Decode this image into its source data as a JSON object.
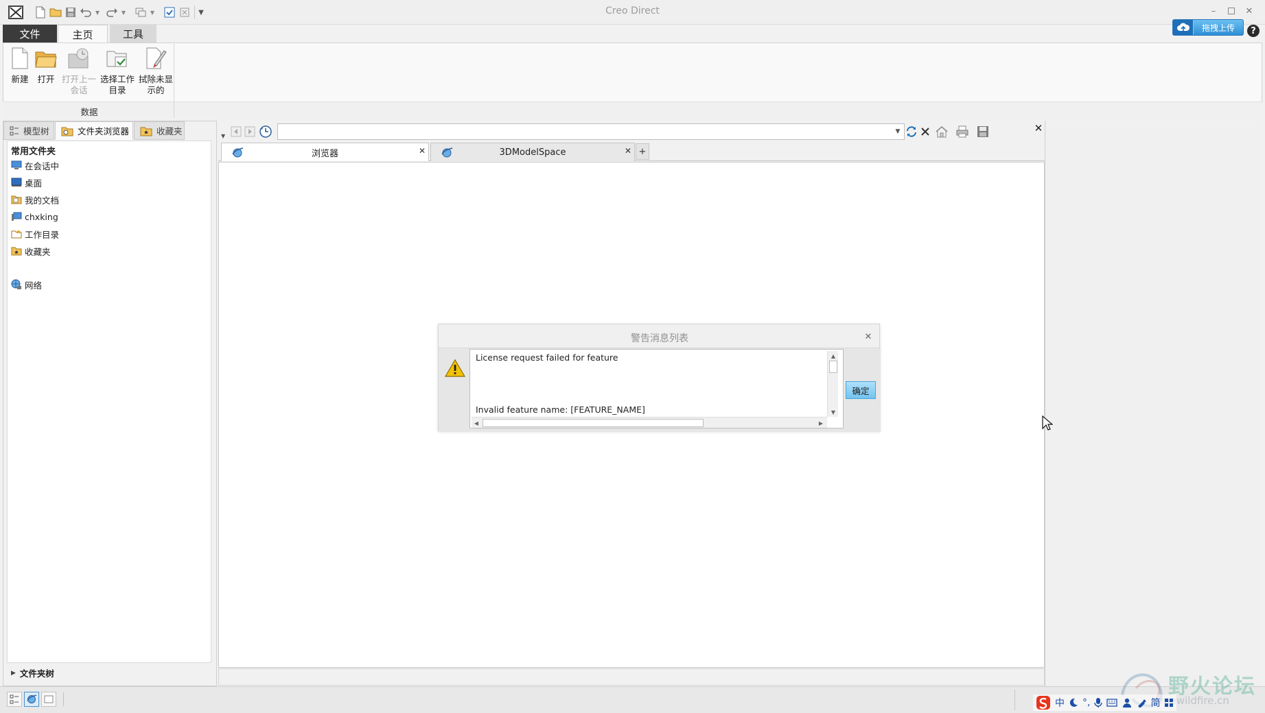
{
  "window": {
    "title": "Creo Direct"
  },
  "menu_tabs": [
    {
      "label": "文件"
    },
    {
      "label": "主页"
    },
    {
      "label": "工具"
    }
  ],
  "upload": {
    "label": "拖拽上传"
  },
  "ribbon": {
    "buttons": [
      {
        "label": "新建",
        "icon": "new-file-icon",
        "enabled": true
      },
      {
        "label": "打开",
        "icon": "open-folder-icon",
        "enabled": true
      },
      {
        "label": "打开上一\n会话",
        "icon": "open-last-session-icon",
        "enabled": false
      },
      {
        "label": "选择工作\n目录",
        "icon": "select-working-dir-icon",
        "enabled": true
      },
      {
        "label": "拭除未显\n示的",
        "icon": "erase-not-displayed-icon",
        "enabled": true
      }
    ],
    "group_label": "数据"
  },
  "left_panel": {
    "tabs": [
      {
        "label": "模型树",
        "icon": "model-tree-icon"
      },
      {
        "label": "文件夹浏览器",
        "icon": "folder-browser-icon"
      },
      {
        "label": "收藏夹",
        "icon": "favorites-icon"
      }
    ],
    "heading": "常用文件夹",
    "items": [
      {
        "label": "在会话中",
        "icon": "in-session-icon"
      },
      {
        "label": "桌面",
        "icon": "desktop-icon"
      },
      {
        "label": "我的文档",
        "icon": "my-documents-icon"
      },
      {
        "label": "chxking",
        "icon": "computer-icon"
      },
      {
        "label": "工作目录",
        "icon": "working-directory-icon"
      },
      {
        "label": "收藏夹",
        "icon": "favorites-folder-icon"
      },
      {
        "label": "网络",
        "icon": "network-icon"
      }
    ],
    "tree_label": "文件夹树"
  },
  "browser": {
    "address": "",
    "tabs": [
      {
        "label": "浏览器"
      },
      {
        "label": "3DModelSpace"
      }
    ],
    "add_tab": "+"
  },
  "dialog": {
    "title": "警告消息列表",
    "lines": [
      "License request failed for feature",
      "Invalid feature name: [FEATURE_NAME]"
    ],
    "ok_label": "确定"
  },
  "ime": {
    "items": [
      "中",
      "简"
    ]
  },
  "watermark": {
    "main": "野火论坛",
    "sub": "proewildfire.cn"
  },
  "colors": {
    "file_tab": "#3b3b3b",
    "upload_button": "#2f8fd6",
    "ok_button": "#73c3ef",
    "warning": "#f2c200",
    "ime_logo": "#e8341c"
  }
}
